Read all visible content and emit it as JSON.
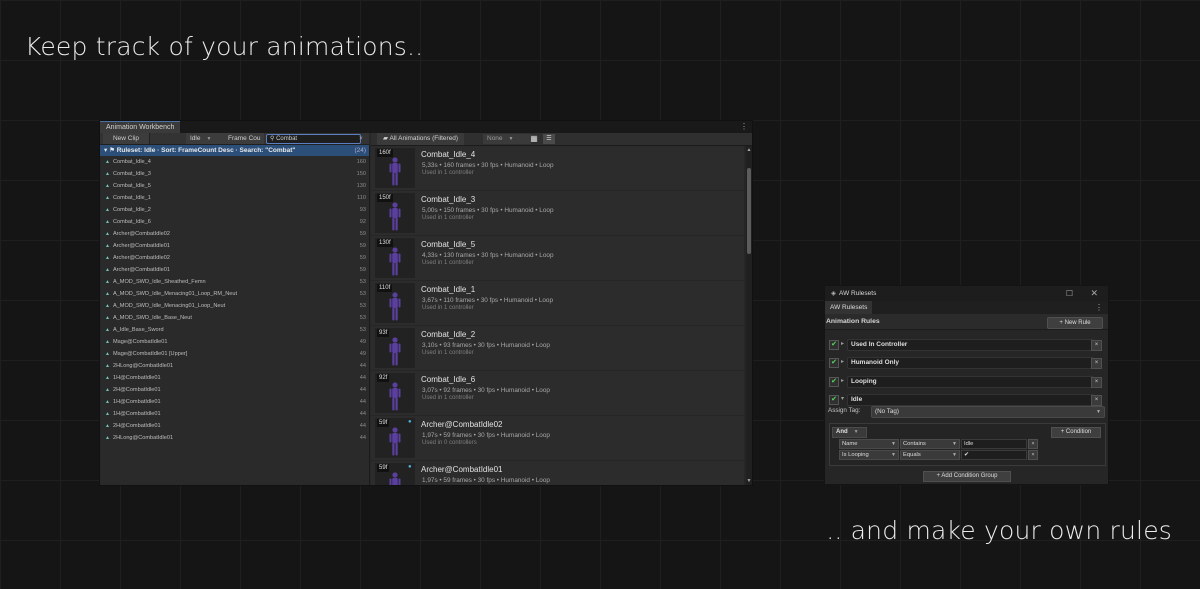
{
  "headlines": {
    "top": "Keep track of your animations..",
    "bottom": ".. and make your own rules"
  },
  "workbench": {
    "tab_title": "Animation Workbench",
    "new_clip": "New Clip",
    "idle_filter": "Idle",
    "frame_filter": "Frame Cou",
    "search_value": "Combat",
    "ruleset_row": {
      "label": "Ruleset: Idle · Sort: FrameCount Desc · Search: \"Combat\"",
      "count": "(24)"
    },
    "clips": [
      {
        "name": "Combat_Idle_4",
        "count": "160"
      },
      {
        "name": "Combat_Idle_3",
        "count": "150"
      },
      {
        "name": "Combat_Idle_5",
        "count": "130"
      },
      {
        "name": "Combat_Idle_1",
        "count": "110"
      },
      {
        "name": "Combat_Idle_2",
        "count": "93"
      },
      {
        "name": "Combat_Idle_6",
        "count": "92"
      },
      {
        "name": "Archer@CombatIdle02",
        "count": "59"
      },
      {
        "name": "Archer@CombatIdle01",
        "count": "59"
      },
      {
        "name": "Archer@CombatIdle02",
        "count": "59"
      },
      {
        "name": "Archer@CombatIdle01",
        "count": "59"
      },
      {
        "name": "A_MOD_SWD_Idle_Sheathed_Femn",
        "count": "53"
      },
      {
        "name": "A_MOD_SWD_Idle_Menacing01_Loop_RM_Neut",
        "count": "53"
      },
      {
        "name": "A_MOD_SWD_Idle_Menacing01_Loop_Neut",
        "count": "53"
      },
      {
        "name": "A_MOD_SWD_Idle_Base_Neut",
        "count": "53"
      },
      {
        "name": "A_Idle_Base_Sword",
        "count": "53"
      },
      {
        "name": "Mage@CombatIdle01",
        "count": "49"
      },
      {
        "name": "Mage@CombatIdle01 [Upper]",
        "count": "49"
      },
      {
        "name": "2HLong@CombatIdle01",
        "count": "44"
      },
      {
        "name": "1H@CombatIdle01",
        "count": "44"
      },
      {
        "name": "2H@CombatIdle01",
        "count": "44"
      },
      {
        "name": "1H@CombatIdle01",
        "count": "44"
      },
      {
        "name": "1H@CombatIdle01",
        "count": "44"
      },
      {
        "name": "2H@CombatIdle01",
        "count": "44"
      },
      {
        "name": "2HLong@CombatIdle01",
        "count": "44"
      }
    ],
    "right_toolbar": {
      "all_animations": "All Animations (Filtered)",
      "none_dd": "None"
    },
    "cards": [
      {
        "badge": "160f",
        "title": "Combat_Idle_4",
        "meta": "5,33s • 160 frames • 30 fps • Humanoid • Loop",
        "usage": "Used in 1 controller",
        "warn": false
      },
      {
        "badge": "150f",
        "title": "Combat_Idle_3",
        "meta": "5,00s • 150 frames • 30 fps • Humanoid • Loop",
        "usage": "Used in 1 controller",
        "warn": false
      },
      {
        "badge": "130f",
        "title": "Combat_Idle_5",
        "meta": "4,33s • 130 frames • 30 fps • Humanoid • Loop",
        "usage": "Used in 1 controller",
        "warn": false
      },
      {
        "badge": "110f",
        "title": "Combat_Idle_1",
        "meta": "3,67s • 110 frames • 30 fps • Humanoid • Loop",
        "usage": "Used in 1 controller",
        "warn": false
      },
      {
        "badge": "93f",
        "title": "Combat_Idle_2",
        "meta": "3,10s • 93 frames • 30 fps • Humanoid • Loop",
        "usage": "Used in 1 controller",
        "warn": false
      },
      {
        "badge": "92f",
        "title": "Combat_Idle_6",
        "meta": "3,07s • 92 frames • 30 fps • Humanoid • Loop",
        "usage": "Used in 1 controller",
        "warn": false
      },
      {
        "badge": "59f",
        "title": "Archer@CombatIdle02",
        "meta": "1,97s • 59 frames • 30 fps • Humanoid • Loop",
        "usage": "Used in 0 controllers",
        "warn": true
      },
      {
        "badge": "59f",
        "title": "Archer@CombatIdle01",
        "meta": "1,97s • 59 frames • 30 fps • Humanoid • Loop",
        "usage": "",
        "warn": true
      }
    ]
  },
  "rulesets": {
    "window_title": "AW Rulesets",
    "tab": "AW Rulesets",
    "header": "Animation Rules",
    "new_rule": "+ New Rule",
    "rules": [
      "Used In Controller",
      "Humanoid Only",
      "Looping",
      "Idle"
    ],
    "assign_label": "Assign Tag:",
    "assign_value": "(No Tag)",
    "logic": "And",
    "add_condition": "+ Condition",
    "conditions": [
      {
        "field": "Name",
        "op": "Contains",
        "value": "Idle"
      },
      {
        "field": "Is Looping",
        "op": "Equals",
        "value": "✔"
      }
    ],
    "add_group": "+ Add Condition Group"
  },
  "colors": {
    "accent_blue": "#2c4f7a",
    "check_green": "#57d65f",
    "figure_purple": "#5b3f9e"
  }
}
